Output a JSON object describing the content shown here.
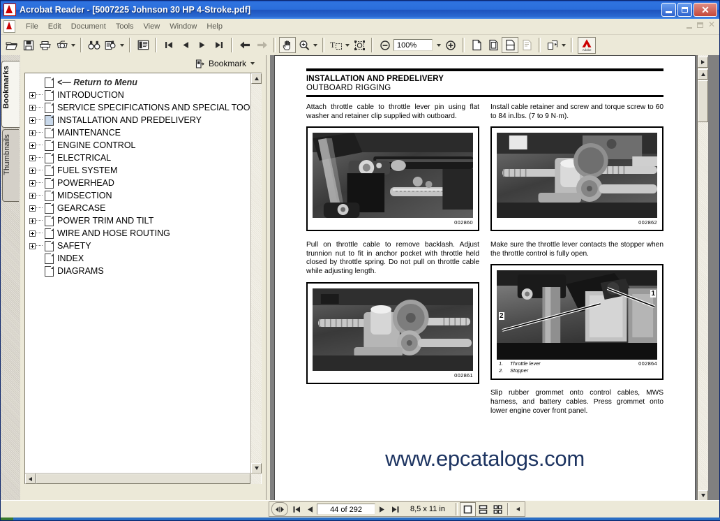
{
  "window": {
    "title": "Acrobat Reader - [5007225 Johnson 30 HP 4-Stroke.pdf]",
    "app_icon": "acrobat-icon",
    "minimize": "_",
    "restore": "□",
    "close": "✕"
  },
  "menu": {
    "items": [
      "File",
      "Edit",
      "Document",
      "Tools",
      "View",
      "Window",
      "Help"
    ]
  },
  "toolbar": {
    "zoom_value": "100%",
    "buttons": [
      "open-file",
      "save-file",
      "print",
      "print-setup",
      "find",
      "search",
      "show-hide-navigation",
      "first-page",
      "previous-page",
      "next-page",
      "last-page",
      "go-back",
      "go-forward",
      "hand-tool",
      "zoom-in-tool",
      "text-select-tool",
      "graphics-select-tool",
      "zoom-out",
      "zoom-in",
      "actual-size",
      "fit-page",
      "fit-width",
      "reflow",
      "rotate-view",
      "adobe-online"
    ],
    "adobe_label": "Adobe"
  },
  "navpanel": {
    "tabs": [
      {
        "label": "Bookmarks",
        "active": true
      },
      {
        "label": "Thumbnails",
        "active": false
      }
    ],
    "bookmark_menu_label": "Bookmark",
    "bookmarks": [
      {
        "label": "<— Return to Menu",
        "expandable": false,
        "italic": true,
        "selected": false
      },
      {
        "label": "INTRODUCTION",
        "expandable": true,
        "italic": false,
        "selected": false
      },
      {
        "label": "SERVICE SPECIFICATIONS AND SPECIAL TOO",
        "expandable": true,
        "italic": false,
        "selected": false
      },
      {
        "label": "INSTALLATION AND PREDELIVERY",
        "expandable": true,
        "italic": false,
        "selected": true
      },
      {
        "label": "MAINTENANCE",
        "expandable": true,
        "italic": false,
        "selected": false
      },
      {
        "label": "ENGINE CONTROL",
        "expandable": true,
        "italic": false,
        "selected": false
      },
      {
        "label": "ELECTRICAL",
        "expandable": true,
        "italic": false,
        "selected": false
      },
      {
        "label": "FUEL SYSTEM",
        "expandable": true,
        "italic": false,
        "selected": false
      },
      {
        "label": "POWERHEAD",
        "expandable": true,
        "italic": false,
        "selected": false
      },
      {
        "label": "MIDSECTION",
        "expandable": true,
        "italic": false,
        "selected": false
      },
      {
        "label": "GEARCASE",
        "expandable": true,
        "italic": false,
        "selected": false
      },
      {
        "label": "POWER TRIM AND TILT",
        "expandable": true,
        "italic": false,
        "selected": false
      },
      {
        "label": "WIRE AND HOSE ROUTING",
        "expandable": true,
        "italic": false,
        "selected": false
      },
      {
        "label": "SAFETY",
        "expandable": true,
        "italic": false,
        "selected": false
      },
      {
        "label": "INDEX",
        "expandable": false,
        "italic": false,
        "selected": false
      },
      {
        "label": "DIAGRAMS",
        "expandable": false,
        "italic": false,
        "selected": false
      }
    ]
  },
  "document": {
    "heading": "INSTALLATION AND PREDELIVERY",
    "subheading": "OUTBOARD RIGGING",
    "left_column": {
      "p1": "Attach throttle cable to throttle lever pin using flat washer and retainer clip supplied with outboard.",
      "fig1_number": "002860",
      "p2": "Pull on throttle cable to remove backlash. Adjust trunnion nut to fit in anchor pocket with throttle held closed by throttle spring. Do not pull on throttle cable while adjusting length.",
      "fig2_number": "002861"
    },
    "right_column": {
      "p1": "Install cable retainer and screw and torque screw to 60 to 84 in.lbs. (7 to 9 N·m).",
      "fig1_number": "002862",
      "p2": "Make sure the throttle lever contacts the stopper when the throttle control is fully open.",
      "fig2_number": "002864",
      "fig2_callout_1": "1",
      "fig2_callout_2": "2",
      "fig2_legend": [
        {
          "num": "1.",
          "text": "Throttle lever"
        },
        {
          "num": "2.",
          "text": "Stopper"
        }
      ],
      "p3": "Slip rubber grommet onto control cables, MWS harness, and battery cables. Press grommet onto lower engine cover front panel."
    },
    "watermark": "www.epcatalogs.com"
  },
  "status": {
    "page_indicator": "44 of 292",
    "page_size": "8,5 x 11 in",
    "modes": [
      "single-page",
      "continuous",
      "continuous-facing"
    ]
  },
  "colors": {
    "title_bar": "#2a6ddb",
    "chrome": "#ece9d8",
    "close_button": "#c4473a",
    "watermark": "#1d3461",
    "doc_background": "#808080",
    "selected_bookmark_icon": "#c8d8ea"
  }
}
